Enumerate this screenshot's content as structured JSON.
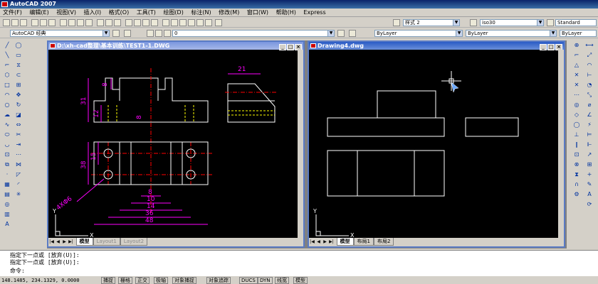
{
  "app": {
    "title": "AutoCAD 2007"
  },
  "menu": [
    "文件(F)",
    "编辑(E)",
    "视图(V)",
    "插入(I)",
    "格式(O)",
    "工具(T)",
    "绘图(D)",
    "标注(N)",
    "修改(M)",
    "窗口(W)",
    "帮助(H)",
    "Express"
  ],
  "toolbar": {
    "text_style": "样式 2",
    "dim_style": "iso30",
    "table_style": "Standard",
    "workspace": "AutoCAD 经典",
    "layer": "0",
    "color": "ByLayer",
    "linetype": "ByLayer",
    "lineweight": "ByLayer"
  },
  "windows": {
    "left": {
      "title": "D:\\xh-cad整理\\基本训练\\TEST1-1.DWG",
      "tabs": [
        "模型",
        "Layout1",
        "Layout2"
      ]
    },
    "right": {
      "title": "Drawing4.dwg",
      "tabs": [
        "模型",
        "布局1",
        "布局2"
      ]
    }
  },
  "drawing": {
    "dims": [
      "8",
      "31",
      "12",
      "8",
      "21",
      "38",
      "15",
      "4XΦ6",
      "8",
      "10",
      "14",
      "36",
      "48"
    ],
    "axis_y": "Y",
    "axis_x": "X"
  },
  "colors": {
    "magenta": "#ff00ff",
    "yellow": "#ffff00",
    "red": "#ff0000",
    "white": "#ffffff"
  },
  "command": {
    "lines": [
      "指定下一点或 [放弃(U)]:",
      "指定下一点或 [放弃(U)]:",
      "命令:"
    ]
  },
  "status": {
    "coords": "148.1485, 234.1329, 0.0000",
    "buttons": [
      "捕捉",
      "栅格",
      "正交",
      "极轴",
      "对象捕捉",
      "对象追踪",
      "DUCS",
      "DYN",
      "线宽",
      "模型"
    ]
  }
}
